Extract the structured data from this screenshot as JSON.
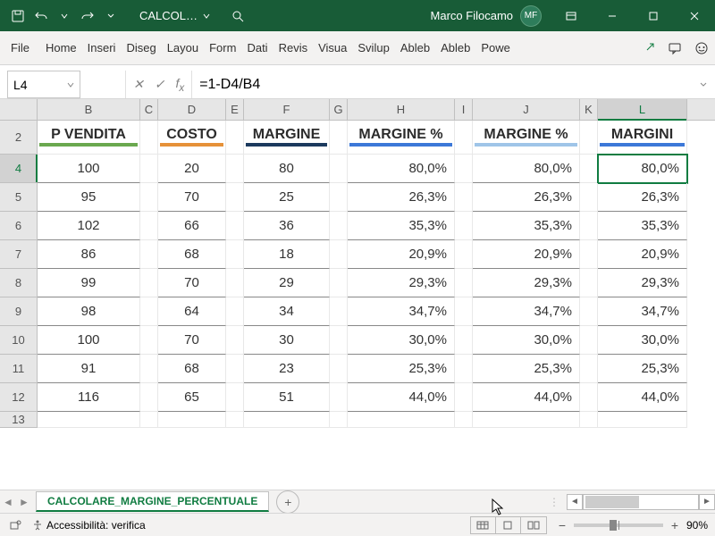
{
  "titlebar": {
    "doc_name": "CALCOL…",
    "user_name": "Marco Filocamo",
    "user_initials": "MF"
  },
  "ribbon": {
    "tabs": [
      "File",
      "Home",
      "Inseri",
      "Diseg",
      "Layou",
      "Form",
      "Dati",
      "Revis",
      "Visua",
      "Svilup",
      "Ableb",
      "Ableb",
      "Powe"
    ]
  },
  "formula_bar": {
    "cell_ref": "L4",
    "formula": "=1-D4/B4"
  },
  "columns": {
    "letters": [
      "B",
      "C",
      "D",
      "E",
      "F",
      "G",
      "H",
      "I",
      "J",
      "K",
      "L"
    ],
    "widths": [
      "cB",
      "cC",
      "cD",
      "cE",
      "cF",
      "cG",
      "cH",
      "cI",
      "cJ",
      "cK",
      "cL"
    ],
    "selected": "L"
  },
  "headers": {
    "B": "P VENDITA",
    "D": "COSTO",
    "F": "MARGINE",
    "H": "MARGINE %",
    "J": "MARGINE %",
    "L": "MARGINI"
  },
  "header_colors": {
    "B": "#6aa84f",
    "D": "#e69138",
    "F": "#1c3a5e",
    "H": "#3c78d8",
    "J": "#9fc5e8",
    "L": "#3c78d8"
  },
  "rows": [
    {
      "n": "4",
      "B": "100",
      "D": "20",
      "F": "80",
      "H": "80,0%",
      "J": "80,0%",
      "L": "80,0%"
    },
    {
      "n": "5",
      "B": "95",
      "D": "70",
      "F": "25",
      "H": "26,3%",
      "J": "26,3%",
      "L": "26,3%"
    },
    {
      "n": "6",
      "B": "102",
      "D": "66",
      "F": "36",
      "H": "35,3%",
      "J": "35,3%",
      "L": "35,3%"
    },
    {
      "n": "7",
      "B": "86",
      "D": "68",
      "F": "18",
      "H": "20,9%",
      "J": "20,9%",
      "L": "20,9%"
    },
    {
      "n": "8",
      "B": "99",
      "D": "70",
      "F": "29",
      "H": "29,3%",
      "J": "29,3%",
      "L": "29,3%"
    },
    {
      "n": "9",
      "B": "98",
      "D": "64",
      "F": "34",
      "H": "34,7%",
      "J": "34,7%",
      "L": "34,7%"
    },
    {
      "n": "10",
      "B": "100",
      "D": "70",
      "F": "30",
      "H": "30,0%",
      "J": "30,0%",
      "L": "30,0%"
    },
    {
      "n": "11",
      "B": "91",
      "D": "68",
      "F": "23",
      "H": "25,3%",
      "J": "25,3%",
      "L": "25,3%"
    },
    {
      "n": "12",
      "B": "116",
      "D": "65",
      "F": "51",
      "H": "44,0%",
      "J": "44,0%",
      "L": "44,0%"
    }
  ],
  "selected_row": "4",
  "selected_cell": {
    "row": "4",
    "col": "L"
  },
  "sheet_tab": "CALCOLARE_MARGINE_PERCENTUALE",
  "status": {
    "accessibility": "Accessibilità: verifica",
    "zoom": "90%"
  }
}
